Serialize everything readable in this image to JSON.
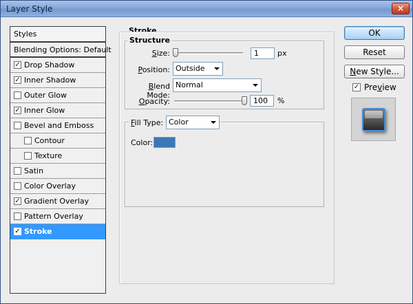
{
  "window": {
    "title": "Layer Style",
    "close_glyph": "×"
  },
  "styles_list": {
    "header": "Styles",
    "items": [
      {
        "label": "Blending Options: Default",
        "checkbox": false,
        "checked": false,
        "sub": false
      },
      {
        "label": "Drop Shadow",
        "checkbox": true,
        "checked": true,
        "sub": false
      },
      {
        "label": "Inner Shadow",
        "checkbox": true,
        "checked": true,
        "sub": false
      },
      {
        "label": "Outer Glow",
        "checkbox": true,
        "checked": false,
        "sub": false
      },
      {
        "label": "Inner Glow",
        "checkbox": true,
        "checked": true,
        "sub": false
      },
      {
        "label": "Bevel and Emboss",
        "checkbox": true,
        "checked": false,
        "sub": false
      },
      {
        "label": "Contour",
        "checkbox": true,
        "checked": false,
        "sub": true
      },
      {
        "label": "Texture",
        "checkbox": true,
        "checked": false,
        "sub": true
      },
      {
        "label": "Satin",
        "checkbox": true,
        "checked": false,
        "sub": false
      },
      {
        "label": "Color Overlay",
        "checkbox": true,
        "checked": false,
        "sub": false
      },
      {
        "label": "Gradient Overlay",
        "checkbox": true,
        "checked": true,
        "sub": false
      },
      {
        "label": "Pattern Overlay",
        "checkbox": true,
        "checked": false,
        "sub": false
      },
      {
        "label": "Stroke",
        "checkbox": true,
        "checked": true,
        "sub": false,
        "selected": true
      }
    ],
    "check_glyph": "✓"
  },
  "stroke": {
    "group_title": "Stroke",
    "structure": {
      "title": "Structure",
      "size": {
        "label": "Size:",
        "accesskey": "S",
        "value": "1",
        "unit": "px",
        "slider_fraction": 0.0
      },
      "position": {
        "label": "Position:",
        "accesskey": "P",
        "selected": "Outside"
      },
      "blend_mode": {
        "label": "Blend Mode:",
        "accesskey": "B",
        "selected": "Normal"
      },
      "opacity": {
        "label": "Opacity:",
        "accesskey": "O",
        "value": "100",
        "unit": "%",
        "slider_fraction": 1.0
      }
    },
    "fill": {
      "fill_type": {
        "label": "Fill Type:",
        "accesskey": "F",
        "selected": "Color"
      },
      "color": {
        "label": "Color:",
        "swatch": "#3c78b6"
      }
    }
  },
  "buttons": {
    "ok": "OK",
    "reset": "Reset",
    "new_style": "New Style...",
    "new_style_accesskey": "N"
  },
  "preview": {
    "label": "Preview",
    "accesskey": "v",
    "checked": true
  },
  "colors": {
    "titlebar": "#86a8d9",
    "selection": "#3399ff",
    "stroke_swatch": "#3c78b6",
    "preview_stroke": "#4a8bd0"
  }
}
